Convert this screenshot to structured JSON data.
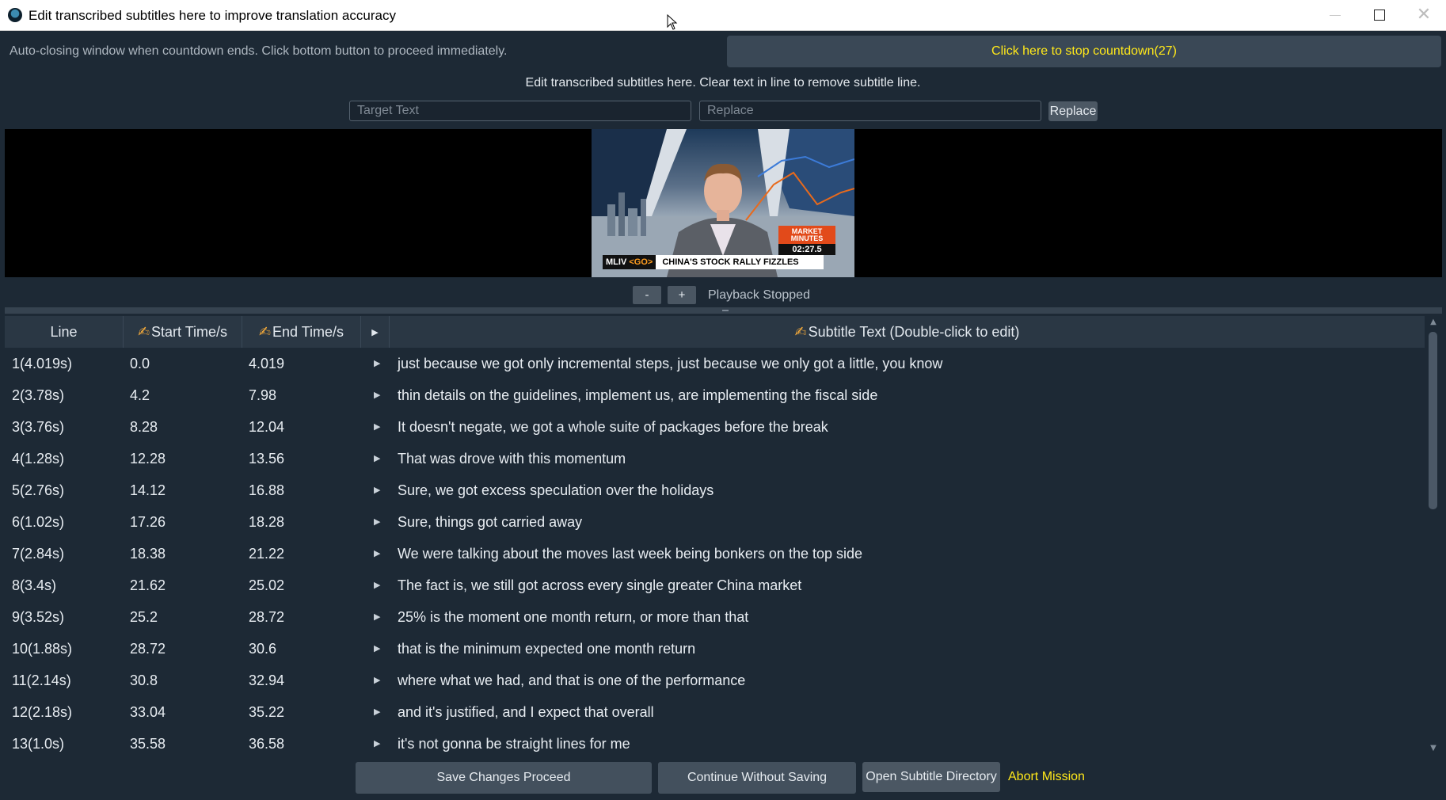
{
  "window": {
    "title": "Edit transcribed subtitles here to improve translation accuracy",
    "app_icon": "app-logo-icon",
    "controls": {
      "minimize": "minimize-icon",
      "maximize": "maximize-icon",
      "close": "close-icon"
    }
  },
  "countdown": {
    "message": "Auto-closing window when countdown ends. Click bottom button to proceed immediately.",
    "stop_label": "Click here to stop countdown(27)"
  },
  "instruction": "Edit transcribed subtitles here. Clear text in line to remove subtitle line.",
  "find_replace": {
    "target_placeholder": "Target Text",
    "replace_placeholder": "Replace",
    "target_value": "",
    "replace_value": "",
    "button_label": "Replace"
  },
  "video": {
    "market_title": "MARKET MINUTES",
    "market_time": "02:27.5",
    "ticker_prefix": "MLIV",
    "ticker_go": "<GO>",
    "headline": "CHINA'S STOCK RALLY FIZZLES"
  },
  "playback": {
    "zoom_out": "-",
    "zoom_in": "+",
    "status": "Playback Stopped"
  },
  "table": {
    "headers": {
      "line": "Line",
      "start": "Start Time/s",
      "end": "End Time/s",
      "text": "Subtitle Text (Double-click to edit)"
    },
    "rows": [
      {
        "line": "1(4.019s)",
        "start": "0.0",
        "end": "4.019",
        "text": "just because we got only incremental steps, just because we only got a little, you know"
      },
      {
        "line": "2(3.78s)",
        "start": "4.2",
        "end": "7.98",
        "text": "thin details on the guidelines, implement us, are implementing the fiscal side"
      },
      {
        "line": "3(3.76s)",
        "start": "8.28",
        "end": "12.04",
        "text": "It doesn't negate, we got a whole suite of packages before the break"
      },
      {
        "line": "4(1.28s)",
        "start": "12.28",
        "end": "13.56",
        "text": "That was drove with this momentum"
      },
      {
        "line": "5(2.76s)",
        "start": "14.12",
        "end": "16.88",
        "text": "Sure, we got excess speculation over the holidays"
      },
      {
        "line": "6(1.02s)",
        "start": "17.26",
        "end": "18.28",
        "text": "Sure, things got carried away"
      },
      {
        "line": "7(2.84s)",
        "start": "18.38",
        "end": "21.22",
        "text": "We were talking about the moves last week being bonkers on the top side"
      },
      {
        "line": "8(3.4s)",
        "start": "21.62",
        "end": "25.02",
        "text": "The fact is, we still got across every single greater China market"
      },
      {
        "line": "9(3.52s)",
        "start": "25.2",
        "end": "28.72",
        "text": "25% is the moment one month return, or more than that"
      },
      {
        "line": "10(1.88s)",
        "start": "28.72",
        "end": "30.6",
        "text": "that is the minimum expected one month return"
      },
      {
        "line": "11(2.14s)",
        "start": "30.8",
        "end": "32.94",
        "text": "where what we had, and that is one of the performance"
      },
      {
        "line": "12(2.18s)",
        "start": "33.04",
        "end": "35.22",
        "text": "and it's justified, and I expect that overall"
      },
      {
        "line": "13(1.0s)",
        "start": "35.58",
        "end": "36.58",
        "text": "it's not gonna be straight lines for me"
      }
    ]
  },
  "buttons": {
    "save": "Save Changes  Proceed",
    "continue": "Continue Without Saving",
    "open_dir": "Open Subtitle Directory",
    "abort": "Abort Mission"
  },
  "colors": {
    "background": "#1d2935",
    "accent_yellow": "#ffe81a",
    "pencil_orange": "#f2a93b"
  }
}
